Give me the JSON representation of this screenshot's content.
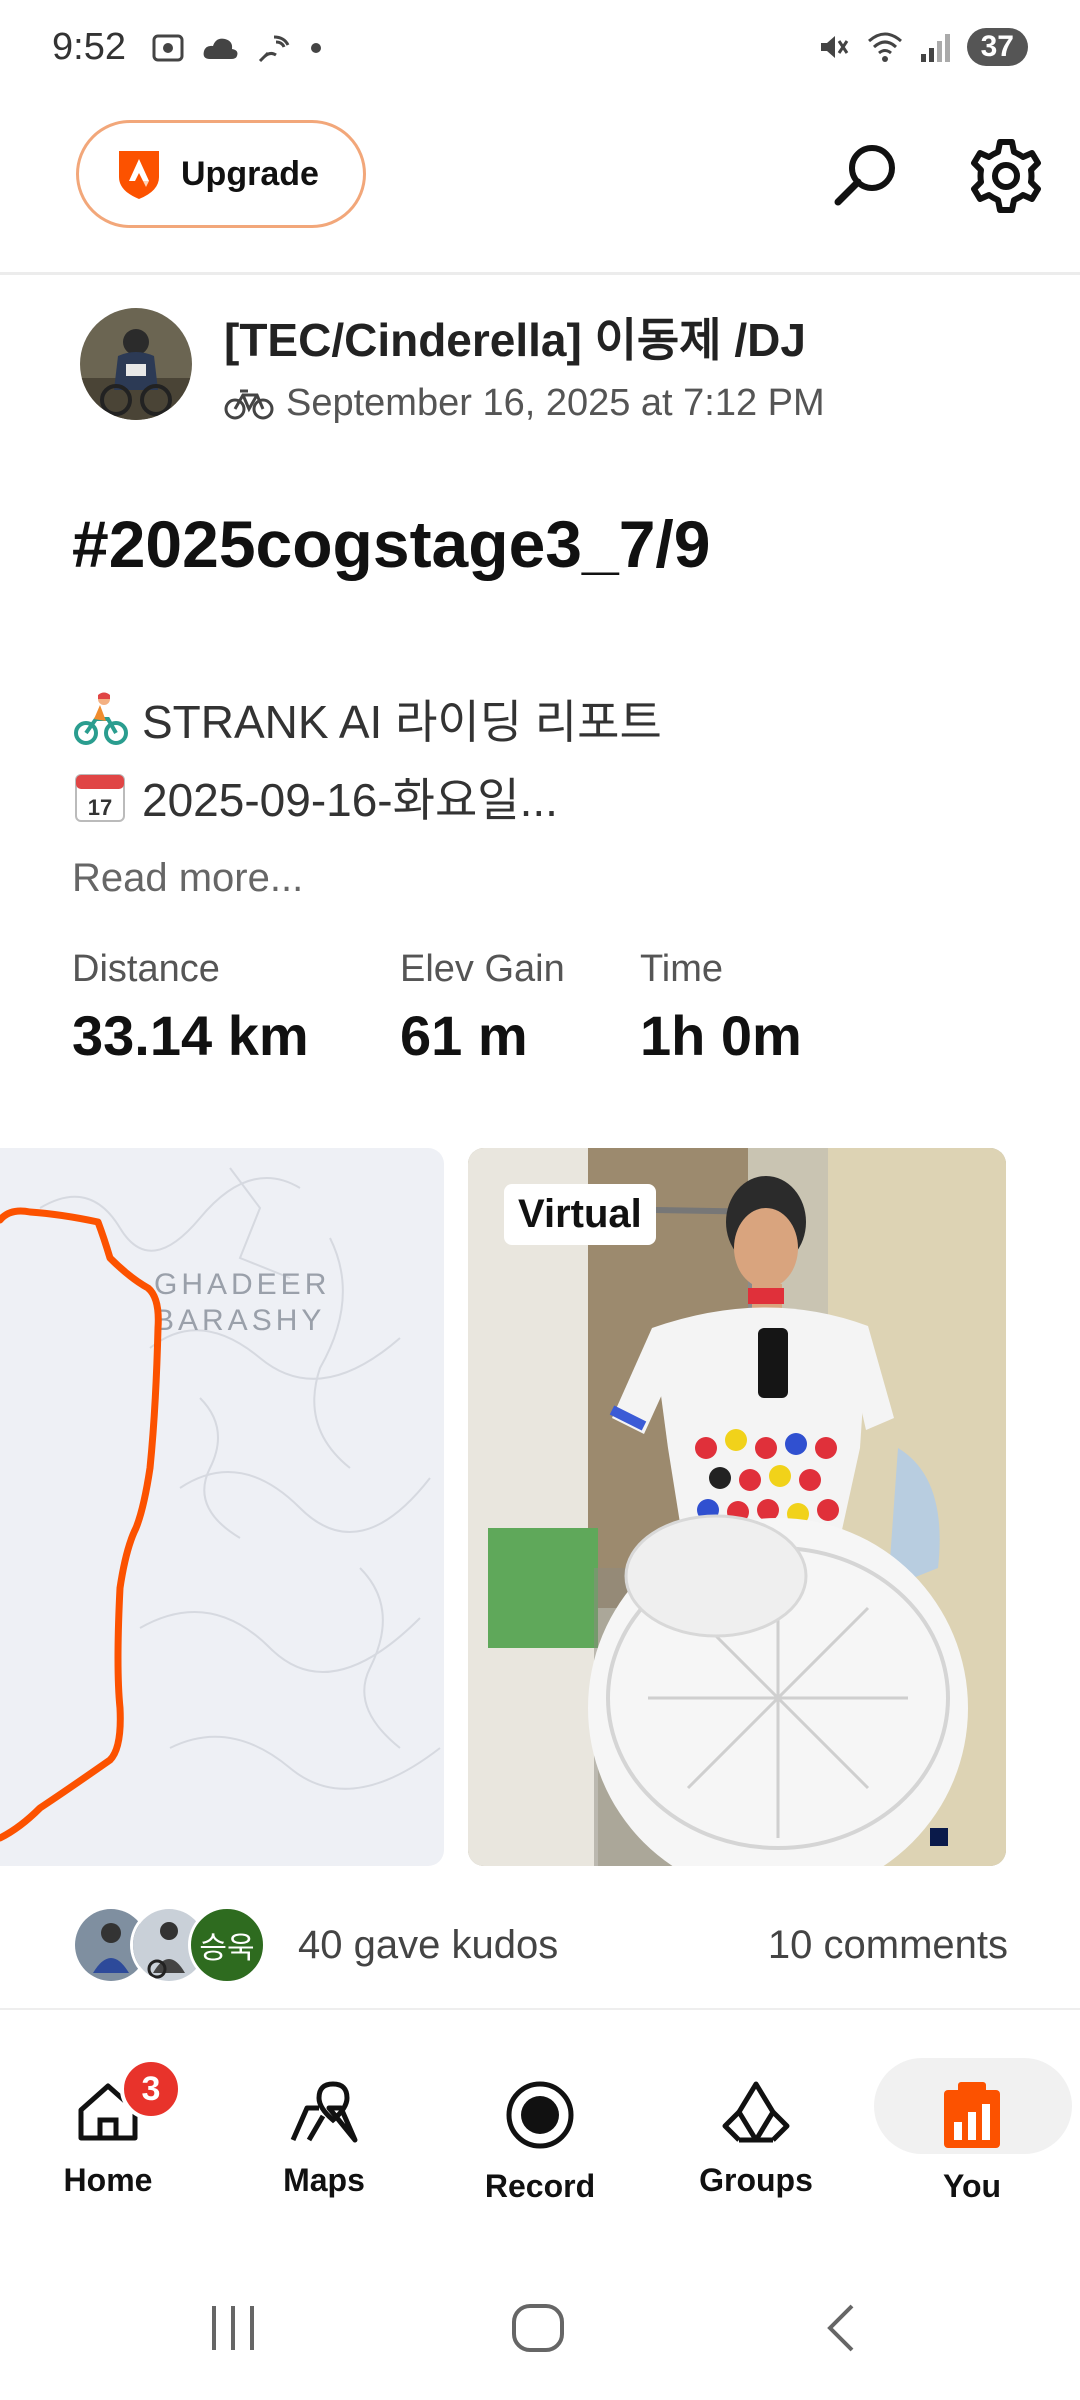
{
  "status_bar": {
    "time": "9:52",
    "battery": "37"
  },
  "top_bar": {
    "upgrade_label": "Upgrade"
  },
  "activity": {
    "athlete_name": "[TEC/Cinderella] 이동제 /DJ",
    "datetime": "September 16, 2025 at 7:12 PM",
    "title": "#2025cogstage3_7/9",
    "description_line1": "STRANK AI 라이딩 리포트",
    "description_line2": "2025-09-16-화요일...",
    "read_more": "Read more...",
    "stats": [
      {
        "label": "Distance",
        "value": "33.14 km"
      },
      {
        "label": "Elev Gain",
        "value": "61 m"
      },
      {
        "label": "Time",
        "value": "1h 0m"
      }
    ],
    "map_place_label_1": "GHADEER",
    "map_place_label_2": "BARASHY",
    "photo_tag": "Virtual",
    "kudos_text": "40 gave kudos",
    "comments_text": "10 comments",
    "kudos_avatar_text": "승욱"
  },
  "nav": {
    "items": [
      {
        "label": "Home",
        "badge": "3"
      },
      {
        "label": "Maps"
      },
      {
        "label": "Record"
      },
      {
        "label": "Groups"
      },
      {
        "label": "You"
      }
    ]
  },
  "colors": {
    "accent": "#fc5200",
    "route": "#fc5200",
    "badge": "#e8332b",
    "upgrade_border": "#f2a77a"
  }
}
